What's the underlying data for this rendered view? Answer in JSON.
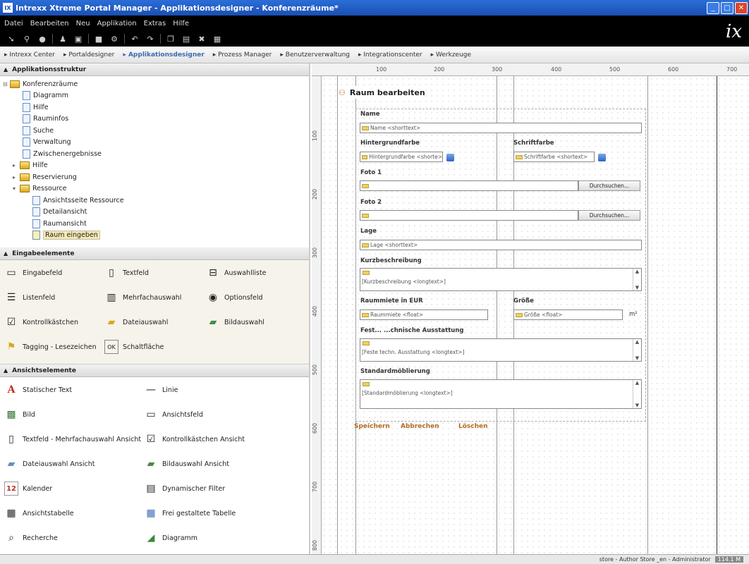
{
  "window": {
    "title": "Intrexx Xtreme Portal Manager - Applikationsdesigner - Konferenzräume*"
  },
  "menu": [
    "Datei",
    "Bearbeiten",
    "Neu",
    "Applikation",
    "Extras",
    "Hilfe"
  ],
  "logo": "ix",
  "nav": [
    "Intrexx Center",
    "Portaldesigner",
    "Applikationsdesigner",
    "Prozess Manager",
    "Benutzerverwaltung",
    "Integrationscenter",
    "Werkzeuge"
  ],
  "structure": {
    "heading": "Applikationsstruktur",
    "root": "Konferenzräume",
    "items": [
      "Diagramm",
      "Hilfe",
      "Rauminfos",
      "Suche",
      "Verwaltung",
      "Zwischenergebnisse"
    ],
    "groups": [
      "Hilfe",
      "Reservierung",
      "Ressource"
    ],
    "subitems": [
      "Ansichtsseite Ressource",
      "Detailansicht",
      "Raumansicht",
      "Raum eingeben"
    ]
  },
  "eingabe": {
    "heading": "Eingabeelemente",
    "items": [
      "Eingabefeld",
      "Textfeld",
      "Auswahlliste",
      "Listenfeld",
      "Mehrfachauswahl",
      "Optionsfeld",
      "Kontrollkästchen",
      "Dateiauswahl",
      "Bildauswahl",
      "Tagging - Lesezeichen",
      "Schaltfläche"
    ]
  },
  "ansicht": {
    "heading": "Ansichtselemente",
    "items": [
      "Statischer Text",
      "Linie",
      "Bild",
      "Ansichtsfeld",
      "Textfeld - Mehrfachauswahl Ansicht",
      "Kontrollkästchen Ansicht",
      "Dateiauswahl Ansicht",
      "Bildauswahl Ansicht",
      "Kalender",
      "Dynamischer Filter",
      "Ansichtstabelle",
      "Frei gestaltete Tabelle",
      "Recherche",
      "Diagramm"
    ]
  },
  "ruler": {
    "top": [
      "100",
      "200",
      "300",
      "400",
      "500",
      "600",
      "700"
    ],
    "left": [
      "100",
      "200",
      "300",
      "400",
      "500",
      "600",
      "700",
      "800"
    ]
  },
  "form": {
    "title": "Raum bearbeiten",
    "labels": {
      "name": "Name",
      "hintergrund": "Hintergrundfarbe",
      "schrift": "Schriftfarbe",
      "foto1": "Foto 1",
      "foto2": "Foto 2",
      "lage": "Lage",
      "kurz": "Kurzbeschreibung",
      "miete": "Raummiete in EUR",
      "groesse": "Größe",
      "fest": "Fest... ...chnische Ausstattung",
      "standard": "Standardmöblierung"
    },
    "fields": {
      "name": "Name <shorttext>",
      "hintergrund": "Hintergrundfarbe <shorte>",
      "schrift": "Schriftfarbe <shortext>",
      "lage": "Lage <shorttext>",
      "kurz": "[Kurzbeschreibung <longtext>]",
      "miete": "Raummiete <float>",
      "groesse": "Größe <float>",
      "fest": "[Feste techn. Ausstattung <longtext>]",
      "standard": "[Standardmöblierung <longtext>]"
    },
    "unit": "m²",
    "browse": "Durchsuchen...",
    "actions": [
      "Speichern",
      "Abbrechen",
      "Löschen"
    ]
  },
  "status": {
    "text": "store - Author Store _en - Administrator",
    "mem": "114.1 M"
  }
}
